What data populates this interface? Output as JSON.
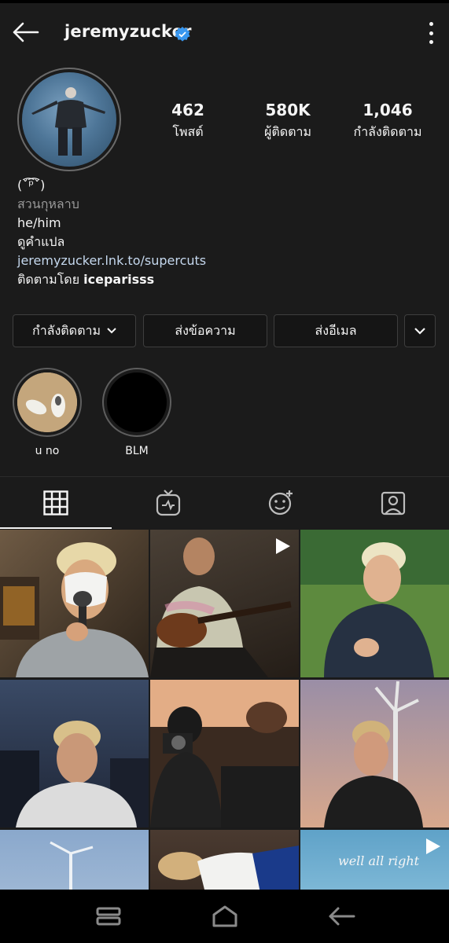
{
  "header": {
    "username": "jeremyzucker"
  },
  "stats": [
    {
      "value": "462",
      "label": "โพสต์"
    },
    {
      "value": "580K",
      "label": "ผู้ติดตาม"
    },
    {
      "value": "1,046",
      "label": "กำลังติดตาม"
    }
  ],
  "bio": {
    "line1": "(ˇ͡ᵖ͡ˇ)",
    "line2": "สวนกุหลาบ",
    "line3": "he/him",
    "line4": "ดูคำแปล",
    "link": "jeremyzucker.lnk.to/supercuts",
    "followed_prefix": "ติดตามโดย ",
    "followed_by": "iceparisss"
  },
  "buttons": {
    "following": "กำลังติดตาม",
    "message": "ส่งข้อความ",
    "email": "ส่งอีเมล"
  },
  "highlights": [
    {
      "label": "u no"
    },
    {
      "label": "BLM"
    }
  ],
  "grid": {
    "video_caption": "well all right"
  },
  "colors": {
    "background": "#1b1b1b",
    "verified": "#3897f0",
    "link": "#c5d8ee"
  },
  "icons": [
    "back-arrow-icon",
    "verified-badge-icon",
    "more-options-icon",
    "grid-icon",
    "igtv-icon",
    "reels-sparkle-icon",
    "tagged-icon",
    "play-icon",
    "recent-apps-icon",
    "home-icon",
    "back-nav-icon"
  ]
}
